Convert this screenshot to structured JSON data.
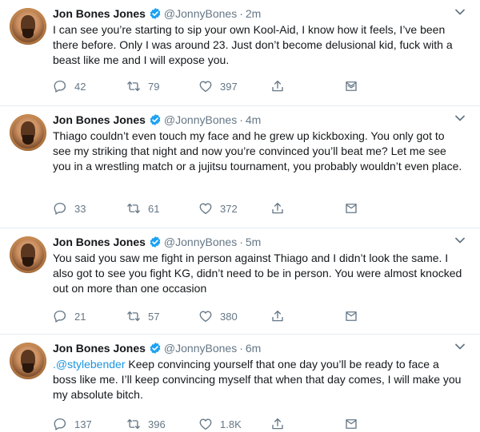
{
  "tweets": [
    {
      "name": "Jon Bones Jones",
      "handle": "@JonnyBones",
      "separator": "·",
      "time": "2m",
      "mention": "",
      "text": "I can see you’re starting to sip your own Kool-Aid, I know how it feels, I’ve been there before. Only I was around 23. Just don’t become delusional kid, fuck with a beast like me and I will expose you.",
      "replies": "42",
      "retweets": "79",
      "likes": "397"
    },
    {
      "name": "Jon Bones Jones",
      "handle": "@JonnyBones",
      "separator": "·",
      "time": "4m",
      "mention": "",
      "text": "Thiago couldn’t even touch my face and he grew up kickboxing. You only got to see my striking that night and now you’re convinced you’ll beat me? Let me see you in a wrestling match or a jujitsu tournament, you probably wouldn’t even place.",
      "replies": "33",
      "retweets": "61",
      "likes": "372"
    },
    {
      "name": "Jon Bones Jones",
      "handle": "@JonnyBones",
      "separator": "·",
      "time": "5m",
      "mention": "",
      "text": "You said you saw me fight in person against Thiago and I didn’t look the same. I also got to see you fight KG, didn’t need to be in person. You were almost knocked out on more than one occasion",
      "replies": "21",
      "retweets": "57",
      "likes": "380"
    },
    {
      "name": "Jon Bones Jones",
      "handle": "@JonnyBones",
      "separator": "·",
      "time": "6m",
      "mention": ".@stylebender",
      "text": " Keep convincing yourself that one day you’ll be ready to face a boss like me. I’ll keep convincing myself that when that day comes, I will make you my absolute bitch.",
      "replies": "137",
      "retweets": "396",
      "likes": "1.8K"
    }
  ],
  "colors": {
    "text": "#14171a",
    "muted": "#657786",
    "verified": "#1da1f2",
    "mention": "#1b95e0",
    "divider": "#e6ecf0"
  },
  "icons": {
    "verified": "verified-badge-icon",
    "caret": "chevron-down-icon",
    "reply": "reply-icon",
    "retweet": "retweet-icon",
    "like": "heart-icon",
    "share": "share-icon",
    "dm": "direct-message-icon"
  }
}
